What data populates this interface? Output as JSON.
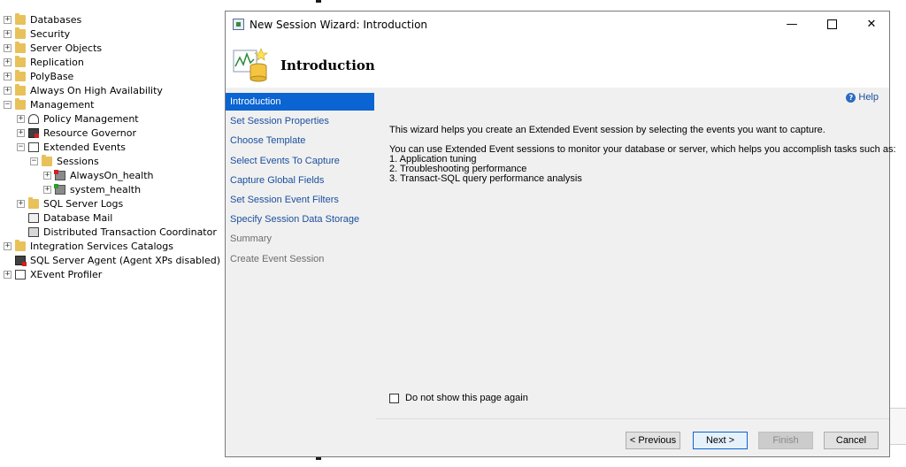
{
  "tree": [
    {
      "label": "Databases",
      "indent": 0,
      "expander": "+",
      "icon": "folder"
    },
    {
      "label": "Security",
      "indent": 0,
      "expander": "+",
      "icon": "folder"
    },
    {
      "label": "Server Objects",
      "indent": 0,
      "expander": "+",
      "icon": "folder"
    },
    {
      "label": "Replication",
      "indent": 0,
      "expander": "+",
      "icon": "folder"
    },
    {
      "label": "PolyBase",
      "indent": 0,
      "expander": "+",
      "icon": "folder"
    },
    {
      "label": "Always On High Availability",
      "indent": 0,
      "expander": "+",
      "icon": "folder"
    },
    {
      "label": "Management",
      "indent": 0,
      "expander": "−",
      "icon": "folder"
    },
    {
      "label": "Policy Management",
      "indent": 1,
      "expander": "+",
      "icon": "policy"
    },
    {
      "label": "Resource Governor",
      "indent": 1,
      "expander": "+",
      "icon": "gov"
    },
    {
      "label": "Extended Events",
      "indent": 1,
      "expander": "−",
      "icon": "ee"
    },
    {
      "label": "Sessions",
      "indent": 2,
      "expander": "−",
      "icon": "folder"
    },
    {
      "label": "AlwaysOn_health",
      "indent": 3,
      "expander": "+",
      "icon": "sess"
    },
    {
      "label": "system_health",
      "indent": 3,
      "expander": "+",
      "icon": "sess-green"
    },
    {
      "label": "SQL Server Logs",
      "indent": 1,
      "expander": "+",
      "icon": "folder"
    },
    {
      "label": "Database Mail",
      "indent": 1,
      "expander": "",
      "icon": "mail"
    },
    {
      "label": "Distributed Transaction Coordinator",
      "indent": 1,
      "expander": "",
      "icon": "dtc"
    },
    {
      "label": "Integration Services Catalogs",
      "indent": 0,
      "expander": "+",
      "icon": "folder"
    },
    {
      "label": "SQL Server Agent (Agent XPs disabled)",
      "indent": 0,
      "expander": "",
      "icon": "agent"
    },
    {
      "label": "XEvent Profiler",
      "indent": 0,
      "expander": "+",
      "icon": "ee"
    }
  ],
  "wizard": {
    "title": "New Session Wizard: Introduction",
    "header_title": "Introduction",
    "help_label": "Help",
    "steps": [
      {
        "label": "Introduction",
        "state": "active"
      },
      {
        "label": "Set Session Properties",
        "state": "link"
      },
      {
        "label": "Choose Template",
        "state": "link"
      },
      {
        "label": "Select Events To Capture",
        "state": "link"
      },
      {
        "label": "Capture Global Fields",
        "state": "link"
      },
      {
        "label": "Set Session Event Filters",
        "state": "link"
      },
      {
        "label": "Specify Session Data Storage",
        "state": "link"
      },
      {
        "label": "Summary",
        "state": "disabled"
      },
      {
        "label": "Create Event Session",
        "state": "disabled"
      }
    ],
    "intro_text": "This wizard helps you create an Extended Event session by selecting the events you want to capture.",
    "usage_text": "You can use Extended Event sessions to monitor your database or server, which helps you accomplish tasks such as:",
    "tasks": [
      "1. Application tuning",
      "2. Troubleshooting performance",
      "3. Transact-SQL query performance analysis"
    ],
    "dont_show_label": "Do not show this page again",
    "buttons": {
      "previous": "< Previous",
      "next": "Next >",
      "finish": "Finish",
      "cancel": "Cancel"
    }
  }
}
